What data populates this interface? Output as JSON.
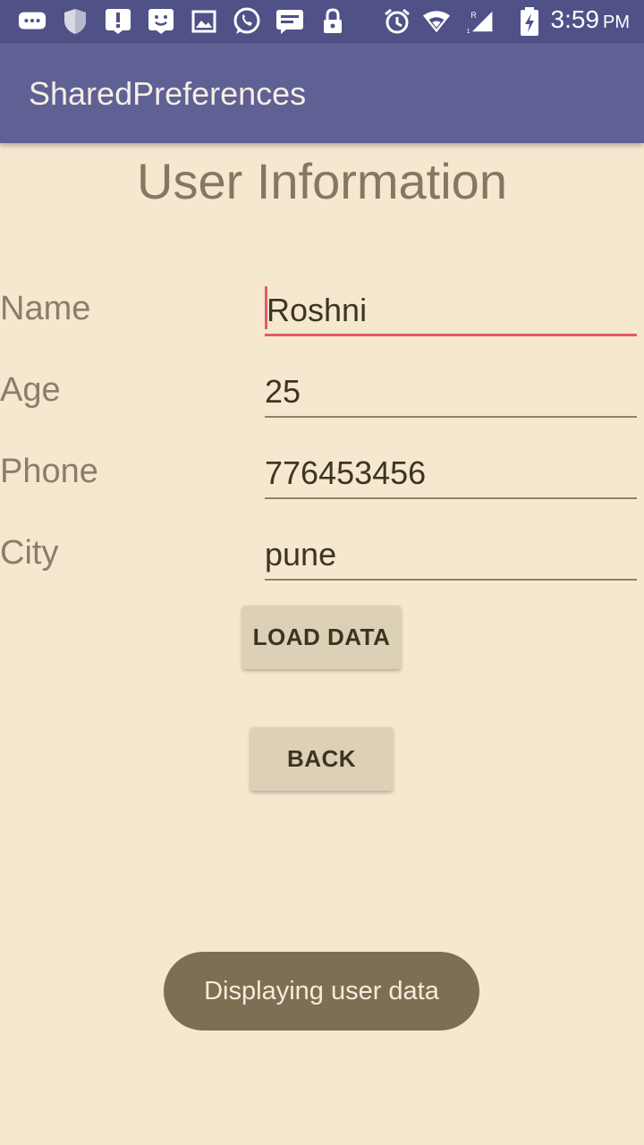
{
  "status_bar": {
    "time": "3:59",
    "ampm": "PM",
    "icons": [
      "chat-bubble-icon",
      "shield-icon",
      "alert-icon",
      "face-icon",
      "image-icon",
      "whatsapp-icon",
      "message-icon",
      "lock-icon",
      "alarm-icon",
      "wifi-icon",
      "signal-icon",
      "battery-charging-icon"
    ],
    "background": "#4f5187"
  },
  "app_bar": {
    "title": "SharedPreferences",
    "background": "#5f6094"
  },
  "page": {
    "title": "User Information",
    "background": "#f6e8cf"
  },
  "form": {
    "fields": [
      {
        "label": "Name",
        "value": "Roshni",
        "focused": true
      },
      {
        "label": "Age",
        "value": "25",
        "focused": false
      },
      {
        "label": "Phone",
        "value": "776453456",
        "focused": false
      },
      {
        "label": "City",
        "value": "pune",
        "focused": false
      }
    ],
    "focus_color": "#e25a6a"
  },
  "buttons": {
    "load_data": "LOAD DATA",
    "back": "BACK"
  },
  "toast": {
    "message": "Displaying user data"
  }
}
